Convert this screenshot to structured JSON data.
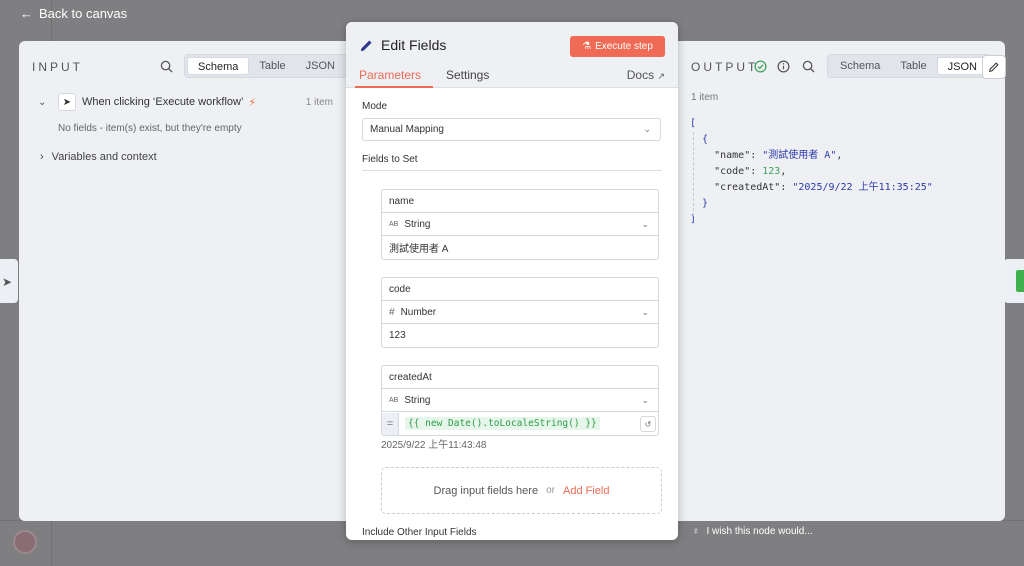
{
  "nav": {
    "back_label": "Back to canvas"
  },
  "input_panel": {
    "title": "INPUT",
    "view_tabs": [
      "Schema",
      "Table",
      "JSON"
    ],
    "active_view": "Schema",
    "trigger": {
      "label": "When clicking ‘Execute workflow’",
      "count": "1 item"
    },
    "empty_message": "No fields - item(s) exist, but they're empty",
    "variables_label": "Variables and context"
  },
  "node": {
    "title": "Edit Fields",
    "execute_label": "Execute step",
    "tabs": [
      "Parameters",
      "Settings"
    ],
    "active_tab": "Parameters",
    "docs_label": "Docs",
    "mode_label": "Mode",
    "mode_value": "Manual Mapping",
    "fields_to_set_label": "Fields to Set",
    "fields": [
      {
        "name": "name",
        "type_icon": "AB",
        "type": "String",
        "value": "測試使用者 A"
      },
      {
        "name": "code",
        "type_icon": "#",
        "type": "Number",
        "value": "123"
      },
      {
        "name": "createdAt",
        "type_icon": "AB",
        "type": "String",
        "expression": "{{ new Date().toLocaleString() }}",
        "preview": "2025/9/22 上午11:43:48"
      }
    ],
    "expr_eq": "=",
    "drop_hint": "Drag input fields here",
    "drop_or": "or",
    "add_field_label": "Add Field",
    "include_label": "Include Other Input Fields"
  },
  "output_panel": {
    "title": "OUTPUT",
    "view_tabs": [
      "Schema",
      "Table",
      "JSON"
    ],
    "active_view": "JSON",
    "items_count": "1 item",
    "json": {
      "open_bracket": "[",
      "open_brace": "{",
      "close_brace": "}",
      "close_bracket": "]",
      "rows": [
        {
          "key": "\"name\"",
          "value": "\"測試使用者 A\"",
          "kind": "string"
        },
        {
          "key": "\"code\"",
          "value": "123",
          "kind": "number"
        },
        {
          "key": "\"createdAt\"",
          "value": "\"2025/9/22 上午11:35:25\"",
          "kind": "string"
        }
      ]
    },
    "feedback": "I wish this node would..."
  },
  "colors": {
    "accent": "#ef6b55",
    "success": "#3fa35b",
    "json_string": "#2c3aa8"
  }
}
